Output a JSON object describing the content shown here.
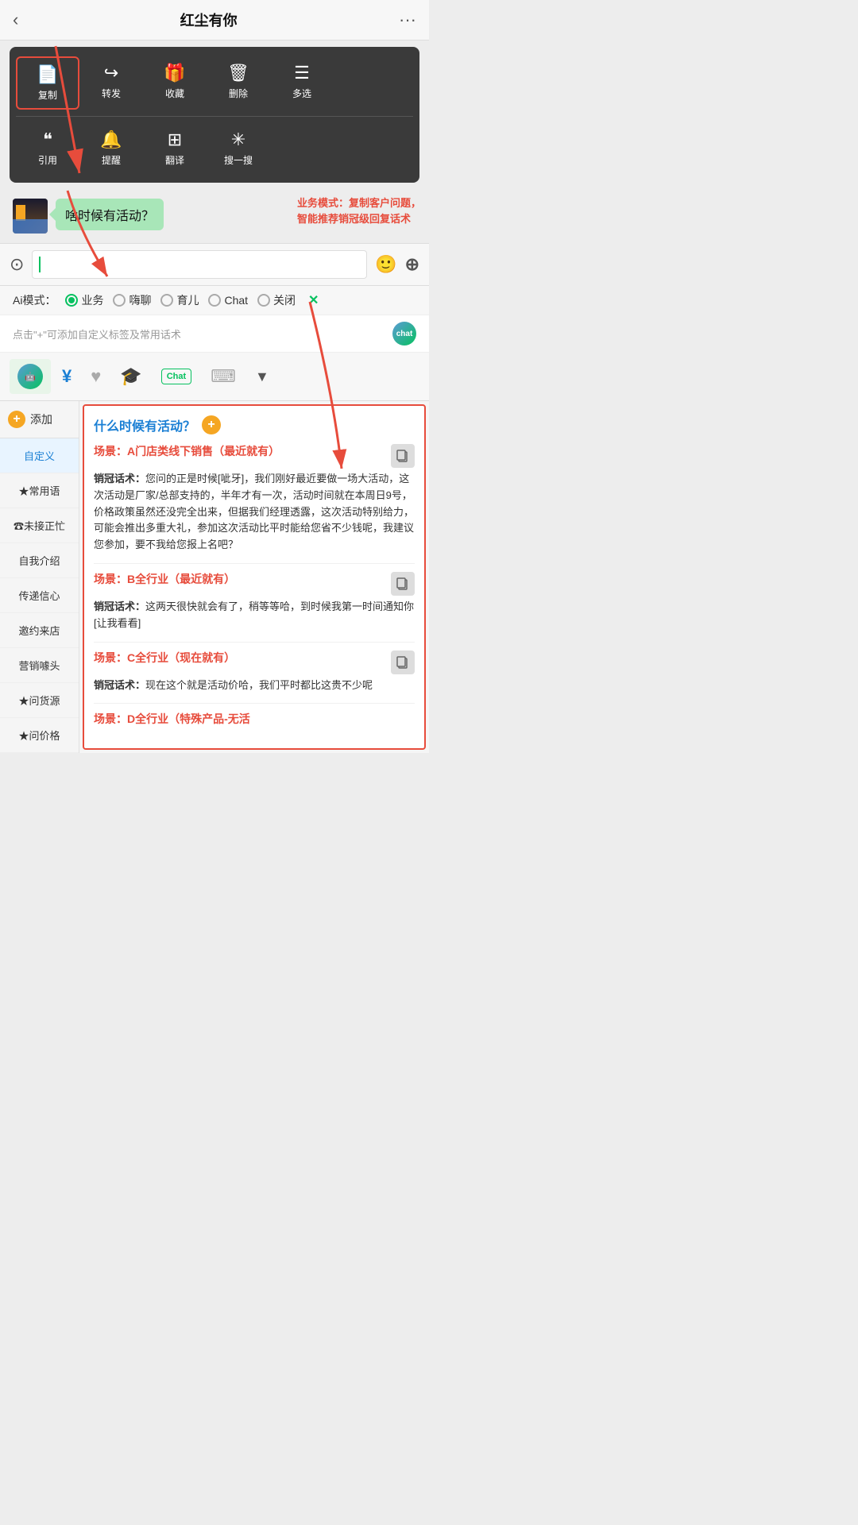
{
  "header": {
    "title": "红尘有你",
    "back_label": "‹",
    "more_label": "···"
  },
  "context_menu": {
    "row1": [
      {
        "icon": "📄",
        "label": "复制",
        "highlighted": true
      },
      {
        "icon": "↪",
        "label": "转发",
        "highlighted": false
      },
      {
        "icon": "🎁",
        "label": "收藏",
        "highlighted": false
      },
      {
        "icon": "🗑",
        "label": "删除",
        "highlighted": false
      },
      {
        "icon": "☰",
        "label": "多选",
        "highlighted": false
      }
    ],
    "row2": [
      {
        "icon": "❝",
        "label": "引用",
        "highlighted": false
      },
      {
        "icon": "🔔",
        "label": "提醒",
        "highlighted": false
      },
      {
        "icon": "⊞",
        "label": "翻译",
        "highlighted": false
      },
      {
        "icon": "✳",
        "label": "搜一搜",
        "highlighted": false
      }
    ]
  },
  "chat": {
    "message": "啥时候有活动？"
  },
  "annotation": {
    "text": "业务模式：复制客户问题，\n智能推荐销冠级回复话术"
  },
  "ai_modes": {
    "label": "Ai模式：",
    "options": [
      {
        "label": "业务",
        "active": true
      },
      {
        "label": "嗨聊",
        "active": false
      },
      {
        "label": "育儿",
        "active": false
      },
      {
        "label": "Chat",
        "active": false
      },
      {
        "label": "关闭",
        "active": false
      }
    ],
    "close_label": "✕"
  },
  "tag_hint": {
    "text": "点击\"+\"可添加自定义标签及常用话术"
  },
  "toolbar": {
    "items": [
      {
        "icon": "robot",
        "label": "chat"
      },
      {
        "icon": "¥",
        "label": "money"
      },
      {
        "icon": "♥",
        "label": "favorite"
      },
      {
        "icon": "🎓",
        "label": "graduation"
      },
      {
        "icon": "chat-text",
        "label": "Chat"
      },
      {
        "icon": "⌨",
        "label": "keyboard"
      },
      {
        "icon": "▼",
        "label": "expand"
      }
    ]
  },
  "sidebar": {
    "add_label": "添加",
    "items": [
      {
        "label": "自定义",
        "active": true
      },
      {
        "label": "★常用语",
        "active": false
      },
      {
        "label": "☎未接正忙",
        "active": false
      },
      {
        "label": "自我介绍",
        "active": false
      },
      {
        "label": "传递信心",
        "active": false
      },
      {
        "label": "邀约来店",
        "active": false
      },
      {
        "label": "营销噱头",
        "active": false
      },
      {
        "label": "★问货源",
        "active": false
      },
      {
        "label": "★问价格",
        "active": false
      }
    ]
  },
  "main_panel": {
    "query": "什么时候有活动？",
    "scenes": [
      {
        "title": "场景：A门店类线下销售（最近就有）",
        "content_label": "销冠话术：",
        "content": "您问的正是时候[呲牙]，我们刚好最近要做一场大活动，这次活动是厂家/总部支持的，半年才有一次，活动时间就在本周日9号，价格政策虽然还没完全出来，但据我们经理透露，这次活动特别给力，可能会推出多重大礼，参加这次活动比平时能给您省不少钱呢，我建议您参加，要不我给您报上名吧？"
      },
      {
        "title": "场景：B全行业（最近就有）",
        "content_label": "销冠话术：",
        "content": "这两天很快就会有了，稍等等哈，到时候我第一时间通知你[让我看看]"
      },
      {
        "title": "场景：C全行业（现在就有）",
        "content_label": "销冠话术：",
        "content": "现在这个就是活动价哈，我们平时都比这贵不少呢"
      },
      {
        "title": "场景：D全行业（特殊产品-无活",
        "content_label": "",
        "content": ""
      }
    ]
  }
}
